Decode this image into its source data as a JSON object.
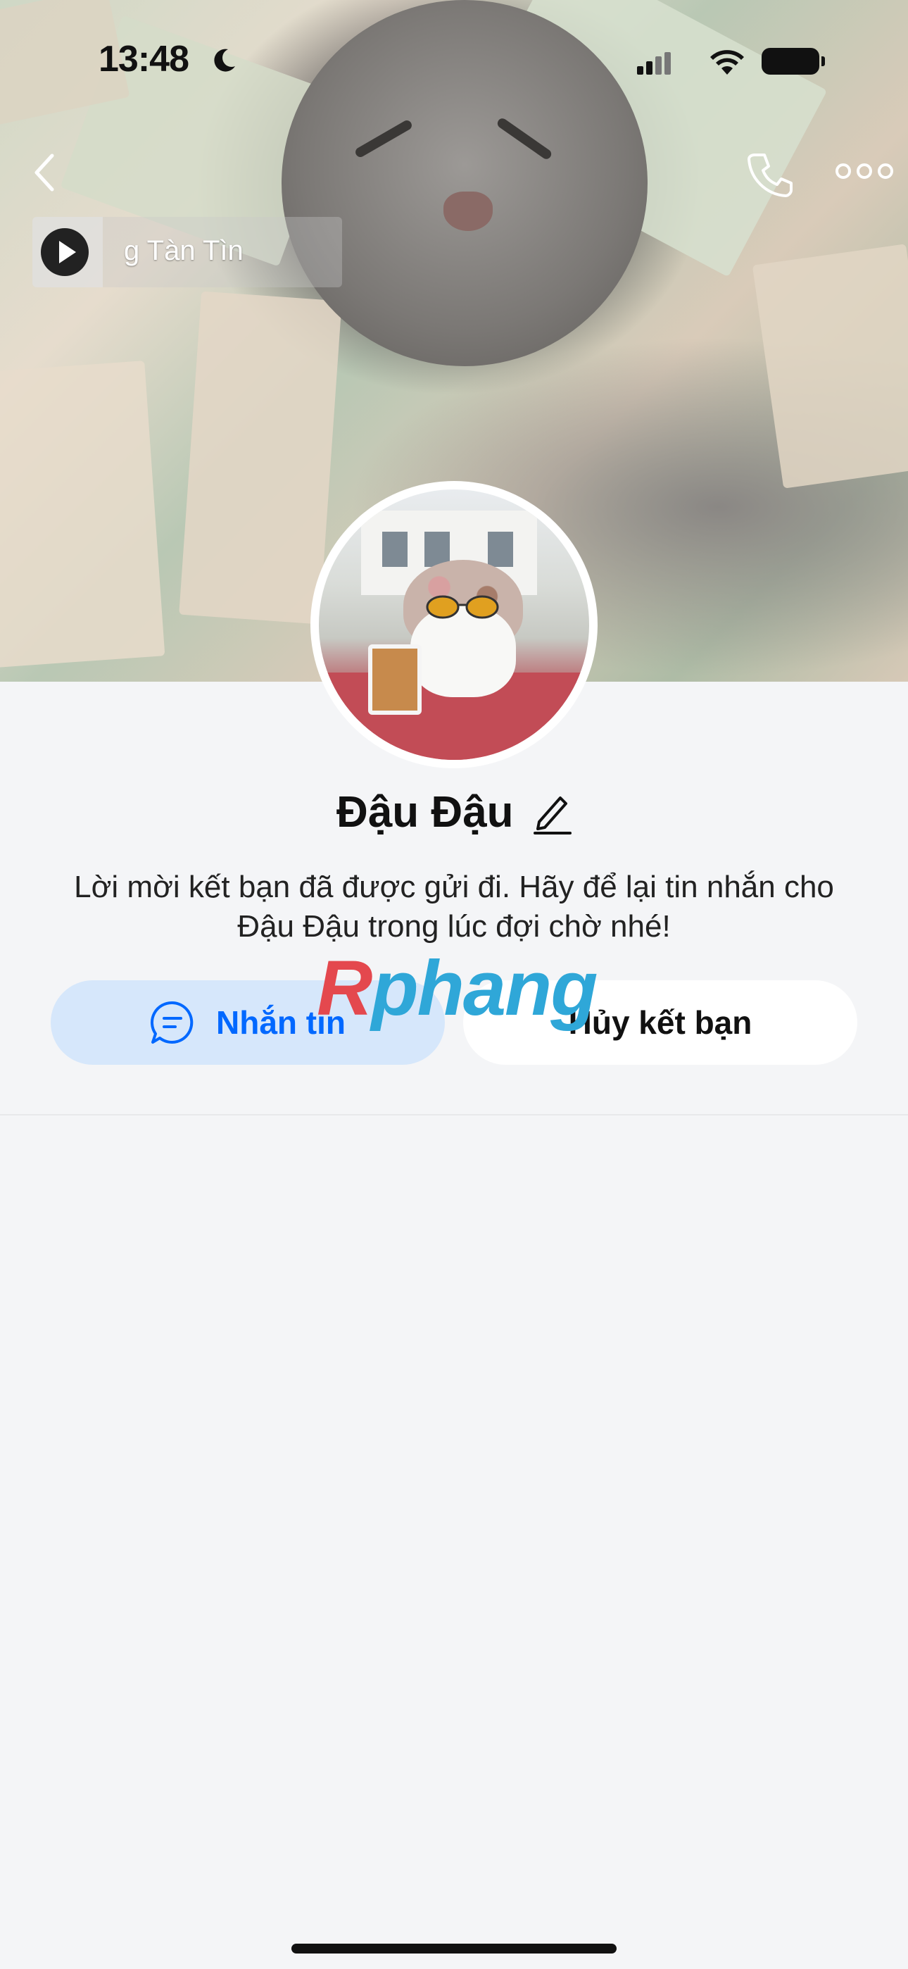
{
  "status_bar": {
    "time": "13:48",
    "icons": [
      "moon-icon",
      "signal-icon",
      "wifi-icon",
      "battery-icon"
    ]
  },
  "nav": {
    "icons": [
      "back-icon",
      "phone-icon",
      "more-icon"
    ]
  },
  "music_banner": {
    "title": "g Tàn        Tìn",
    "icon": "play-icon"
  },
  "profile": {
    "name": "Đậu Đậu",
    "message": "Lời mời kết bạn đã được gửi đi. Hãy để lại tin nhắn cho Đậu Đậu trong lúc đợi chờ nhé!"
  },
  "actions": {
    "message_label": "Nhắn tin",
    "unfriend_label": "Hủy kết bạn"
  },
  "watermark": {
    "first": "R",
    "rest": "phang"
  },
  "colors": {
    "accent": "#0068ff",
    "message_button_bg": "#d6e7fb",
    "background": "#f4f5f7"
  }
}
